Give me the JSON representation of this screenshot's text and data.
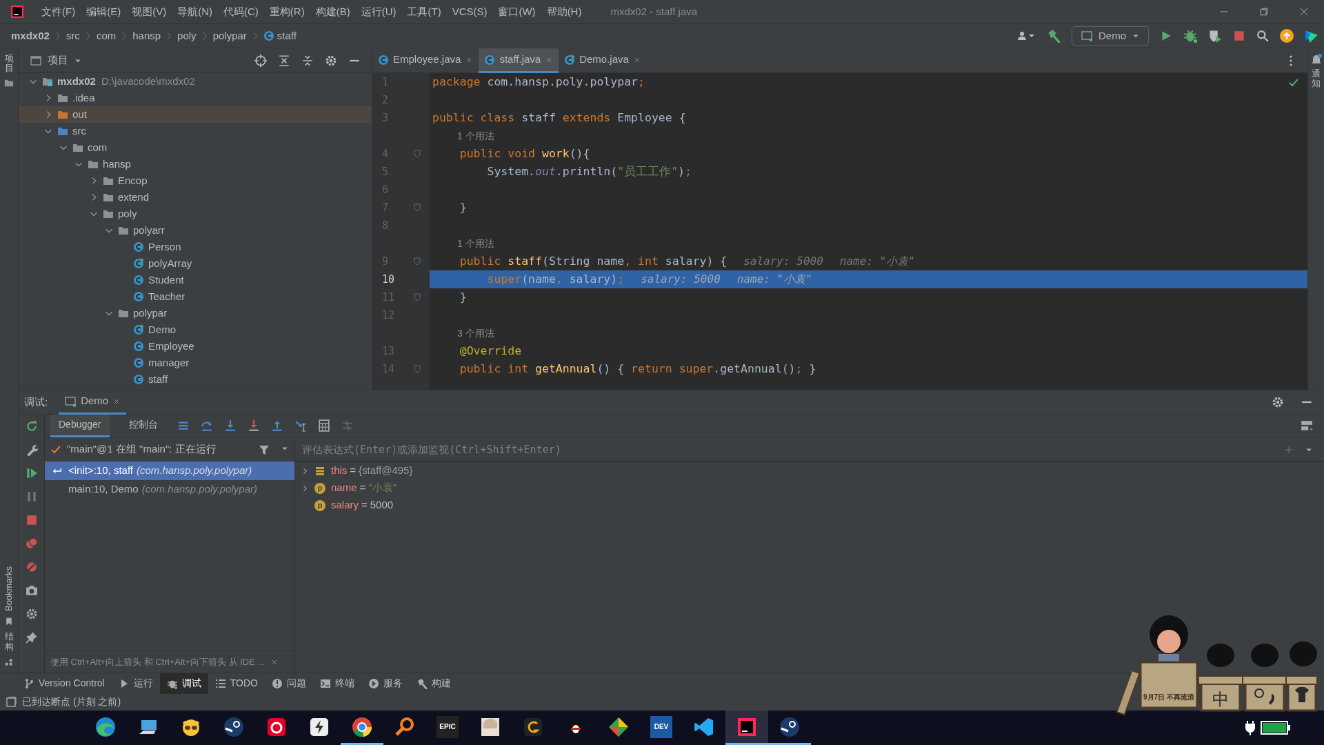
{
  "window": {
    "title": "mxdx02 - staff.java"
  },
  "menu": [
    "文件(F)",
    "编辑(E)",
    "视图(V)",
    "导航(N)",
    "代码(C)",
    "重构(R)",
    "构建(B)",
    "运行(U)",
    "工具(T)",
    "VCS(S)",
    "窗口(W)",
    "帮助(H)"
  ],
  "breadcrumb": [
    {
      "label": "mxdx02",
      "kind": "project"
    },
    {
      "label": "src",
      "kind": "folder"
    },
    {
      "label": "com",
      "kind": "folder"
    },
    {
      "label": "hansp",
      "kind": "folder"
    },
    {
      "label": "poly",
      "kind": "folder"
    },
    {
      "label": "polypar",
      "kind": "folder"
    },
    {
      "label": "staff",
      "kind": "class"
    }
  ],
  "toolbar": {
    "run_config": "Demo"
  },
  "left_strip": {
    "top_label": "项目",
    "bottom_labels": [
      {
        "text": "Bookmarks",
        "kind": "latin"
      },
      {
        "text": "结构",
        "kind": "cjk"
      }
    ]
  },
  "right_strip": {
    "label": "通知"
  },
  "project_panel": {
    "title": "项目",
    "tree": [
      {
        "label": "mxdx02",
        "path": "D:\\javacode\\mxdx02",
        "kind": "module",
        "expanded": true,
        "selected": false,
        "children": [
          {
            "label": ".idea",
            "kind": "folder",
            "expanded": false,
            "selected": false
          },
          {
            "label": "out",
            "kind": "excluded",
            "expanded": false,
            "selected": true
          },
          {
            "label": "src",
            "kind": "source",
            "expanded": true,
            "selected": false,
            "children": [
              {
                "label": "com",
                "kind": "folder",
                "expanded": true,
                "selected": false,
                "children": [
                  {
                    "label": "hansp",
                    "kind": "folder",
                    "expanded": true,
                    "selected": false,
                    "children": [
                      {
                        "label": "Encop",
                        "kind": "folder",
                        "expanded": false,
                        "selected": false
                      },
                      {
                        "label": "extend",
                        "kind": "folder",
                        "expanded": false,
                        "selected": false
                      },
                      {
                        "label": "poly",
                        "kind": "folder",
                        "expanded": true,
                        "selected": false,
                        "children": [
                          {
                            "label": "polyarr",
                            "kind": "folder",
                            "expanded": true,
                            "selected": false,
                            "children": [
                              {
                                "label": "Person",
                                "kind": "class",
                                "selected": false
                              },
                              {
                                "label": "polyArray",
                                "kind": "runnable",
                                "selected": false
                              },
                              {
                                "label": "Student",
                                "kind": "class",
                                "selected": false
                              },
                              {
                                "label": "Teacher",
                                "kind": "class",
                                "selected": false
                              }
                            ]
                          },
                          {
                            "label": "polypar",
                            "kind": "folder",
                            "expanded": true,
                            "selected": false,
                            "children": [
                              {
                                "label": "Demo",
                                "kind": "runnable",
                                "selected": false
                              },
                              {
                                "label": "Employee",
                                "kind": "class",
                                "selected": false
                              },
                              {
                                "label": "manager",
                                "kind": "class",
                                "selected": false
                              },
                              {
                                "label": "staff",
                                "kind": "class",
                                "selected": false
                              }
                            ]
                          }
                        ]
                      }
                    ]
                  }
                ]
              }
            ]
          }
        ]
      }
    ]
  },
  "editor": {
    "tabs": [
      {
        "label": "Employee.java",
        "kind": "class",
        "selected": false
      },
      {
        "label": "staff.java",
        "kind": "class",
        "selected": true
      },
      {
        "label": "Demo.java",
        "kind": "runnable",
        "selected": false
      }
    ],
    "lines": [
      {
        "kind": "code",
        "number": "1",
        "current": false,
        "fold": false,
        "tokens": [
          {
            "text": "package",
            "kind": "keyword"
          },
          {
            "text": " com.hansp.poly.polypar",
            "kind": "plain"
          },
          {
            "text": ";",
            "kind": "keyword"
          }
        ]
      },
      {
        "kind": "code",
        "number": "2",
        "current": false,
        "fold": false
      },
      {
        "kind": "code",
        "number": "3",
        "current": false,
        "fold": false,
        "tokens": [
          {
            "text": "public class",
            "kind": "keyword"
          },
          {
            "text": " staff ",
            "kind": "plain"
          },
          {
            "text": "extends",
            "kind": "keyword"
          },
          {
            "text": " Employee {",
            "kind": "plain"
          }
        ]
      },
      {
        "kind": "usage",
        "text": "1 个用法"
      },
      {
        "kind": "code",
        "number": "4",
        "current": false,
        "fold": true,
        "tokens": [
          {
            "text": "    public void",
            "kind": "keyword"
          },
          {
            "text": " work",
            "kind": "method"
          },
          {
            "text": "(){",
            "kind": "plain"
          }
        ]
      },
      {
        "kind": "code",
        "number": "5",
        "current": false,
        "fold": false,
        "tokens": [
          {
            "text": "        System.",
            "kind": "plain"
          },
          {
            "text": "out",
            "kind": "field"
          },
          {
            "text": ".println(",
            "kind": "plain"
          },
          {
            "text": "\"员工工作\"",
            "kind": "string"
          },
          {
            "text": ")",
            "kind": "plain"
          },
          {
            "text": ";",
            "kind": "keyword"
          }
        ]
      },
      {
        "kind": "code",
        "number": "6",
        "current": false,
        "fold": false
      },
      {
        "kind": "code",
        "number": "7",
        "current": false,
        "fold": true,
        "tokens": [
          {
            "text": "    }",
            "kind": "plain"
          }
        ]
      },
      {
        "kind": "code",
        "number": "8",
        "current": false,
        "fold": false
      },
      {
        "kind": "usage",
        "text": "1 个用法"
      },
      {
        "kind": "code",
        "number": "9",
        "current": false,
        "fold": true,
        "tokens": [
          {
            "text": "    public",
            "kind": "keyword"
          },
          {
            "text": " staff",
            "kind": "method"
          },
          {
            "text": "(String name",
            "kind": "plain"
          },
          {
            "text": ",",
            "kind": "keyword"
          },
          {
            "text": " int",
            "kind": "keyword"
          },
          {
            "text": " salary) {",
            "kind": "plain"
          }
        ],
        "hints": [
          "salary: 5000",
          "name: \"小袁\""
        ]
      },
      {
        "kind": "code",
        "number": "10",
        "current": true,
        "fold": false,
        "tokens": [
          {
            "text": "        super",
            "kind": "keyword"
          },
          {
            "text": "(name",
            "kind": "plain"
          },
          {
            "text": ",",
            "kind": "keyword"
          },
          {
            "text": " salary)",
            "kind": "plain"
          },
          {
            "text": ";",
            "kind": "keyword"
          }
        ],
        "hints": [
          "salary: 5000",
          "name: \"小袁\""
        ]
      },
      {
        "kind": "code",
        "number": "11",
        "current": false,
        "fold": true,
        "tokens": [
          {
            "text": "    }",
            "kind": "plain"
          }
        ]
      },
      {
        "kind": "code",
        "number": "12",
        "current": false,
        "fold": false
      },
      {
        "kind": "usage",
        "text": "3 个用法"
      },
      {
        "kind": "code",
        "number": "13",
        "current": false,
        "fold": false,
        "tokens": [
          {
            "text": "    @Override",
            "kind": "annotation"
          }
        ]
      },
      {
        "kind": "code",
        "number": "14",
        "current": false,
        "fold": true,
        "tokens": [
          {
            "text": "    public int",
            "kind": "keyword"
          },
          {
            "text": " getAnnual",
            "kind": "method"
          },
          {
            "text": "() { ",
            "kind": "plain"
          },
          {
            "text": "return super",
            "kind": "keyword"
          },
          {
            "text": ".getAnnual()",
            "kind": "plain"
          },
          {
            "text": ";",
            "kind": "keyword"
          },
          {
            "text": " }",
            "kind": "plain"
          }
        ]
      }
    ]
  },
  "debug": {
    "label": "调试:",
    "session": "Demo",
    "tabs": [
      {
        "label": "Debugger",
        "selected": true
      },
      {
        "label": "控制台",
        "selected": false
      }
    ],
    "thread": "\"main\"@1 在组 \"main\": 正在运行",
    "frames": [
      {
        "method": "<init>:10, staff",
        "package": "(com.hansp.poly.polypar)",
        "selected": true
      },
      {
        "method": "main:10, Demo",
        "package": "(com.hansp.poly.polypar)",
        "selected": false
      }
    ],
    "hint": "使用 Ctrl+Alt+向上箭头 和 Ctrl+Alt+向下箭头 从 IDE ...",
    "eval_placeholder": "评估表达式(Enter)或添加监视(Ctrl+Shift+Enter)",
    "variables": [
      {
        "name": "this",
        "operator": "=",
        "value": "{staff@495}",
        "kind": "object",
        "color": "#999999",
        "expandable": true
      },
      {
        "name": "name",
        "operator": "=",
        "value": "\"小袁\"",
        "kind": "param",
        "badge": "p",
        "color": "#6a8759",
        "expandable": true
      },
      {
        "name": "salary",
        "operator": "=",
        "value": "5000",
        "kind": "param",
        "badge": "p",
        "color": "#bbbbbb",
        "expandable": false
      }
    ]
  },
  "tool_tabs": [
    {
      "label": "Version Control",
      "kind": "vcs",
      "selected": false
    },
    {
      "label": "运行",
      "kind": "run",
      "selected": false
    },
    {
      "label": "调试",
      "kind": "debug",
      "selected": true
    },
    {
      "label": "TODO",
      "kind": "list",
      "selected": false
    },
    {
      "label": "问题",
      "kind": "problems",
      "selected": false
    },
    {
      "label": "终端",
      "kind": "terminal",
      "selected": false
    },
    {
      "label": "服务",
      "kind": "services",
      "selected": false
    },
    {
      "label": "构建",
      "kind": "build",
      "selected": false
    }
  ],
  "status_bar": {
    "text": "已到达断点 (片刻 之前)"
  },
  "desktop_widget": {
    "sign": "9月7日 不再流浪",
    "ime": "中"
  },
  "taskbar": {
    "apps": [
      {
        "selected": false,
        "running": false
      },
      {
        "selected": false,
        "running": false
      },
      {
        "selected": false,
        "running": false
      },
      {
        "selected": false,
        "running": false
      },
      {
        "selected": false,
        "running": false
      },
      {
        "selected": false,
        "running": false
      },
      {
        "selected": false,
        "running": true
      },
      {
        "selected": false,
        "running": false
      },
      {
        "selected": false,
        "running": false,
        "label": "EPIC"
      },
      {
        "selected": false,
        "running": false
      },
      {
        "selected": false,
        "running": false
      },
      {
        "selected": false,
        "running": false
      },
      {
        "selected": false,
        "running": false
      },
      {
        "selected": false,
        "running": false,
        "label": "DEV"
      },
      {
        "selected": false,
        "running": false
      },
      {
        "selected": true,
        "running": true
      },
      {
        "selected": false,
        "running": true
      }
    ]
  }
}
